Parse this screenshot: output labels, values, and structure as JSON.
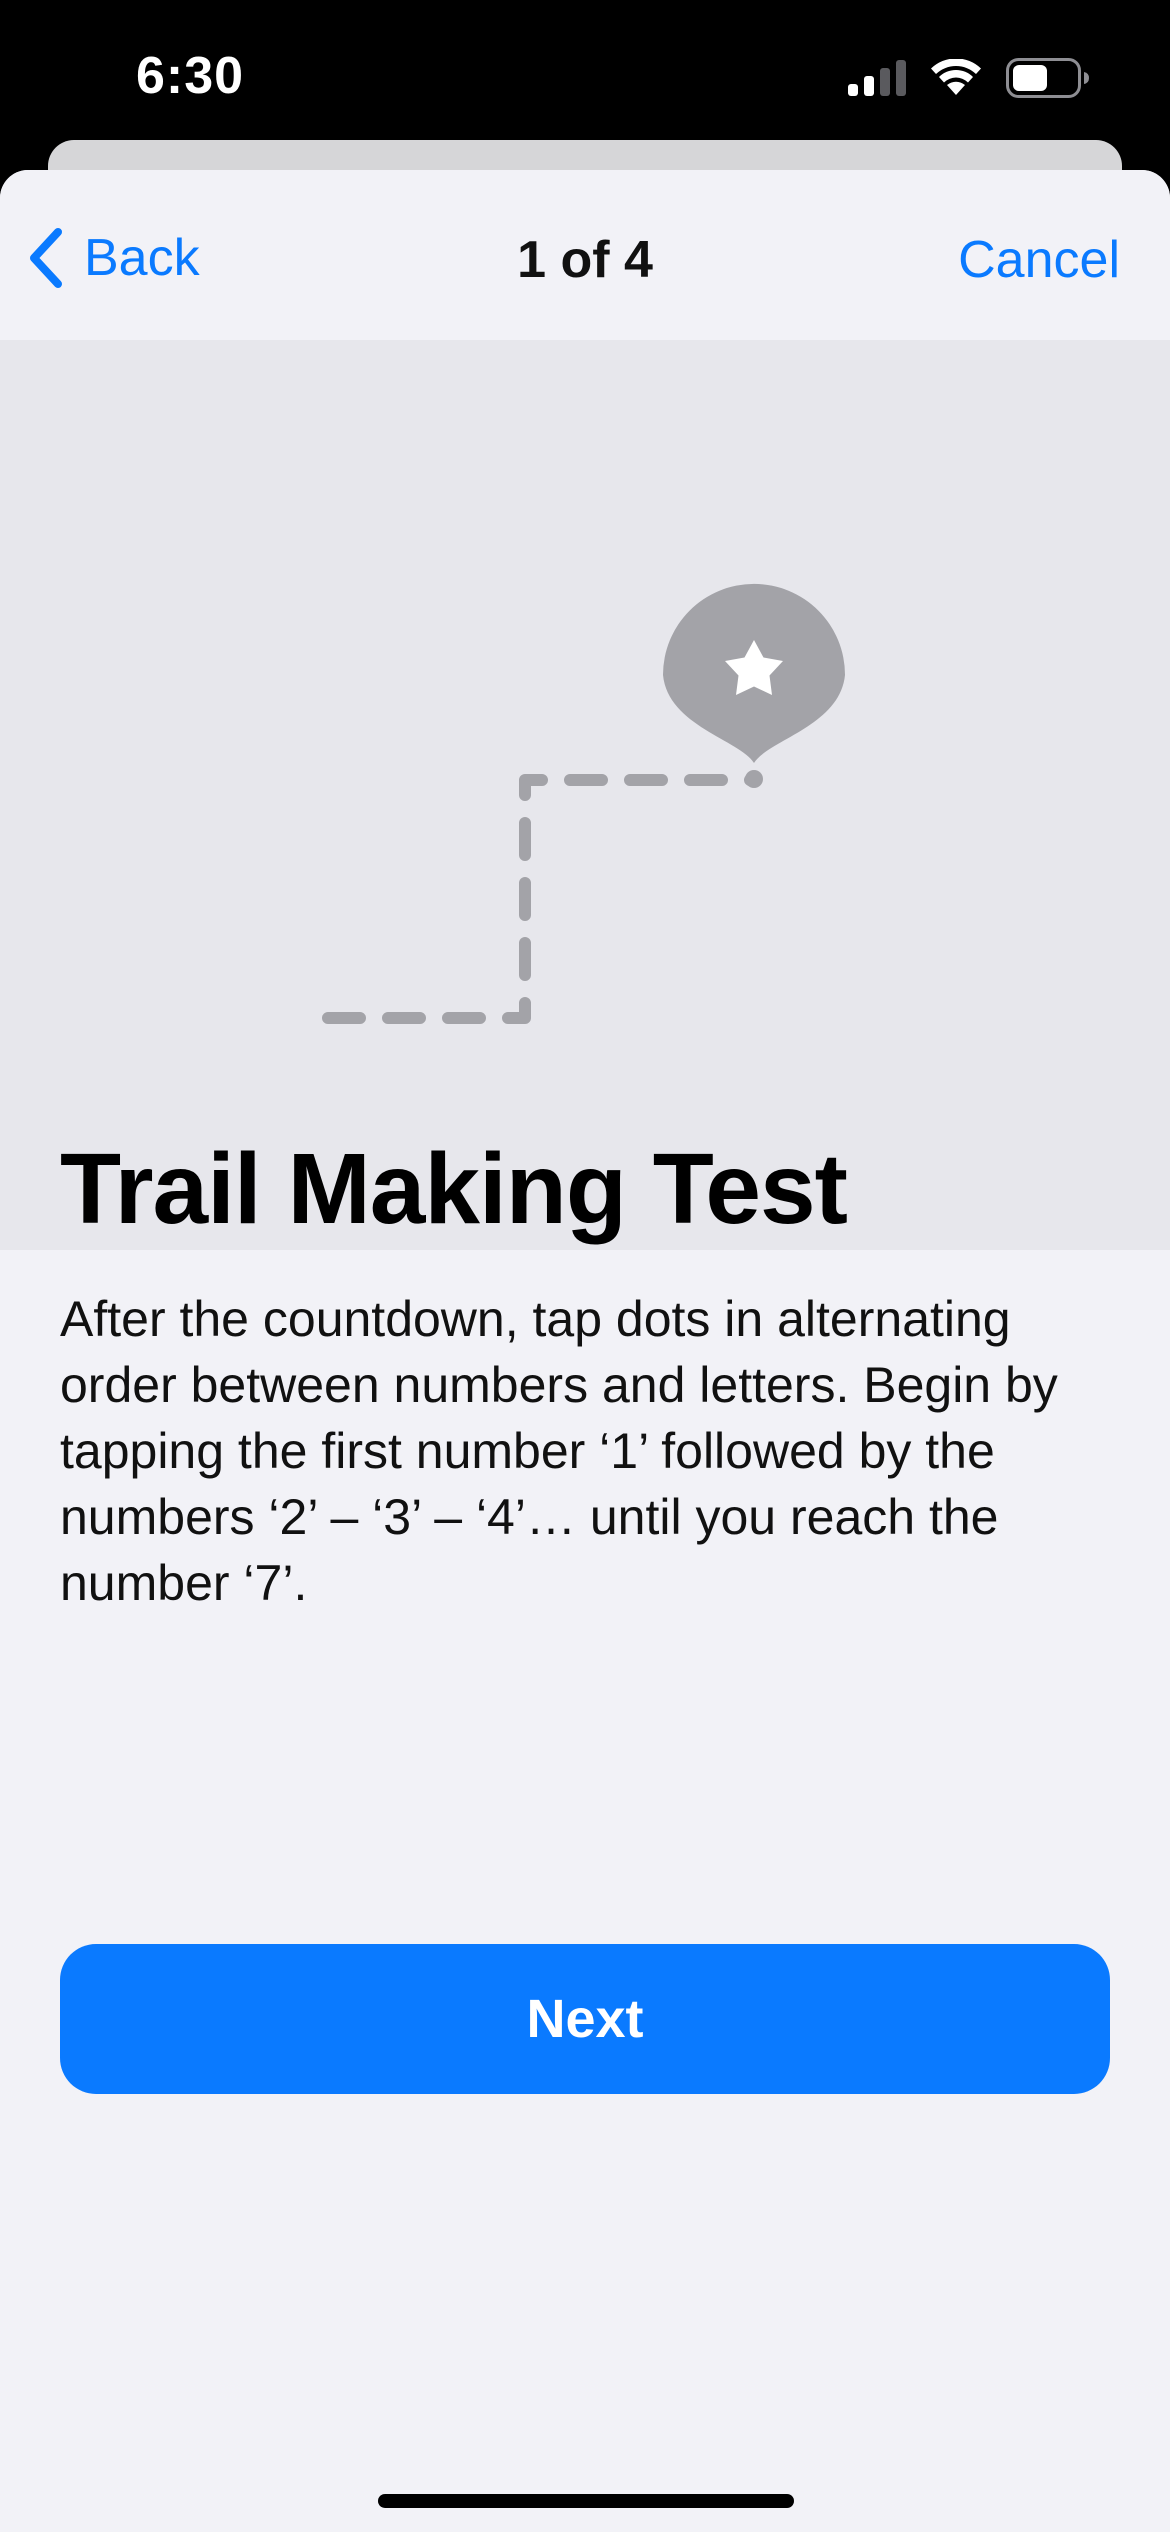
{
  "status_bar": {
    "time": "6:30",
    "icons": [
      "cellular-signal-icon",
      "wifi-icon",
      "battery-icon"
    ]
  },
  "nav": {
    "back_label": "Back",
    "title": "1 of 4",
    "cancel_label": "Cancel"
  },
  "illustration": {
    "icon": "star-pin-icon",
    "path_style": "dashed-trail"
  },
  "content": {
    "title": "Trail Making Test",
    "body": "After the countdown, tap dots in alternating order between numbers and letters. Begin by tapping the first number ‘1’ followed by the numbers ‘2’ – ‘3’ – ‘4’… until you reach the number ‘7’."
  },
  "actions": {
    "next_label": "Next"
  },
  "colors": {
    "accent": "#0a7aff",
    "sheet_background": "#f2f2f7",
    "illustration_background": "#e7e7ec",
    "illustration_gray": "#a3a3a8"
  }
}
